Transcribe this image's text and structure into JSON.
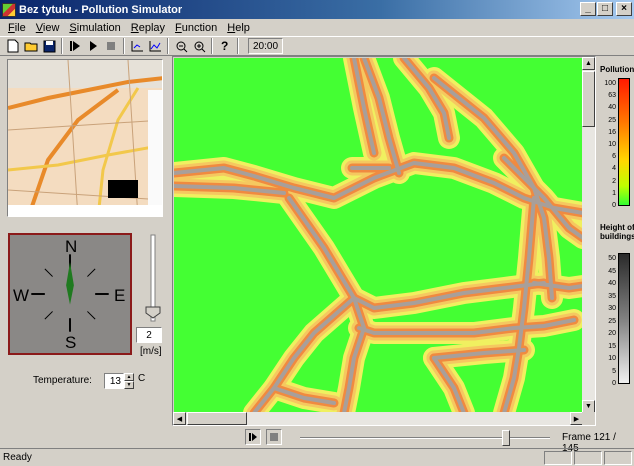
{
  "window": {
    "title": "Bez tytułu - Pollution Simulator",
    "minimize": "_",
    "maximize": "□",
    "close": "×"
  },
  "menu": [
    {
      "label": "File",
      "key": "F",
      "rest": "ile"
    },
    {
      "label": "View",
      "key": "V",
      "rest": "iew"
    },
    {
      "label": "Simulation",
      "key": "S",
      "rest": "imulation"
    },
    {
      "label": "Replay",
      "key": "R",
      "rest": "eplay"
    },
    {
      "label": "Function",
      "key": "F",
      "rest": "unction"
    },
    {
      "label": "Help",
      "key": "H",
      "rest": "elp"
    }
  ],
  "toolbar": {
    "icons": [
      "new-file-icon",
      "open-folder-icon",
      "save-icon",
      "step-forward-icon",
      "play-icon",
      "stop-icon",
      "chart-axes-icon",
      "chart-line-icon",
      "zoom-out-icon",
      "zoom-in-icon",
      "help-icon"
    ],
    "time": "20:00"
  },
  "compass": {
    "north": "N",
    "south": "S",
    "west": "W",
    "east": "E"
  },
  "wind": {
    "speed": "2",
    "unit": "[m/s]"
  },
  "temperature": {
    "label": "Temperature:",
    "value": "13",
    "unit": "C"
  },
  "legend_pollution": {
    "title": "Pollution",
    "ticks": [
      "100",
      "63",
      "40",
      "25",
      "16",
      "10",
      "6",
      "4",
      "2",
      "1",
      "0"
    ]
  },
  "legend_buildings": {
    "title_line1": "Height of",
    "title_line2": "buildings",
    "ticks": [
      "50",
      "45",
      "40",
      "35",
      "30",
      "25",
      "20",
      "15",
      "10",
      "5",
      "0"
    ]
  },
  "replay": {
    "frame_label": "Frame 121 / 145",
    "current_frame": 121,
    "total_frames": 145
  },
  "status": {
    "text": "Ready"
  }
}
